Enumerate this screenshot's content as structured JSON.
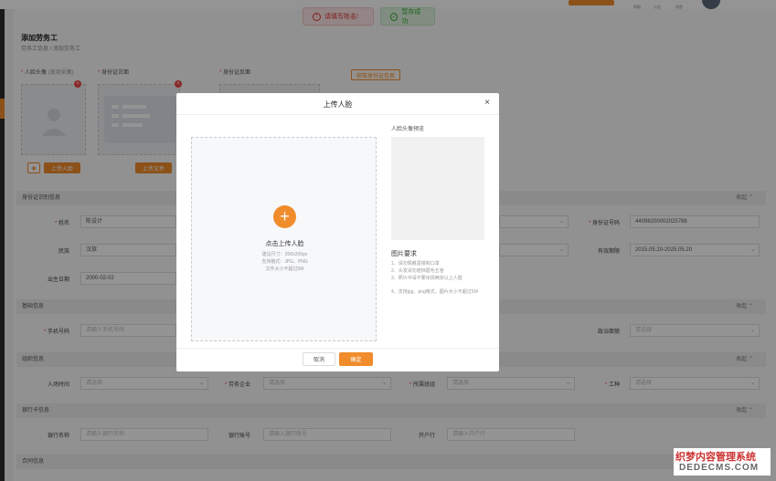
{
  "topbar": {
    "icons": [
      {
        "name": "help-icon",
        "label": "帮助"
      },
      {
        "name": "notice-icon",
        "label": "公告"
      },
      {
        "name": "message-icon",
        "label": "消息"
      }
    ]
  },
  "toasts": {
    "error": "请填写姓名!",
    "success": "暂存成功"
  },
  "page": {
    "title": "添加劳务工",
    "breadcrumb": "劳务工信息 / 添加劳务工"
  },
  "upload": {
    "face_label": "人脸头像",
    "face_hint": "(现场采集)",
    "id_front_label": "身份证正面",
    "id_back_label": "身份证反面",
    "read_id_button": "获取身份证信息",
    "upload_face_button": "上传人脸",
    "upload_file_button": "上传文件"
  },
  "sections": {
    "id_info": "身份证识别信息",
    "basic": "基础信息",
    "org": "组织信息",
    "bank": "银行卡信息",
    "contract": "合同信息",
    "collapse": "收起 ⌃"
  },
  "fields": {
    "name_label": "姓名",
    "name_value": "陈设计",
    "idno_label": "身份证号码",
    "idno_value": "44098200002025788",
    "ethnic_label": "民族",
    "ethnic_value": "汉族",
    "validity_label": "有效期限",
    "validity_value": "2015.05.20-2025.05.20",
    "birth_label": "出生日期",
    "birth_value": "2000-02-02",
    "phone_label": "手机号码",
    "phone_placeholder": "请输入手机号码",
    "politics_label": "政治面貌",
    "politics_placeholder": "请选择",
    "join_label": "入场时间",
    "join_placeholder": "请选择",
    "company_label": "劳务企业",
    "company_placeholder": "请选择",
    "team_label": "所属班组",
    "team_placeholder": "请选择",
    "work_label": "工种",
    "work_placeholder": "请选择",
    "bankname_label": "银行名称",
    "bankname_placeholder": "请输入银行名称",
    "bankno_label": "银行账号",
    "bankno_placeholder": "请输入银行账号",
    "branch_label": "开户行",
    "branch_placeholder": "请输入开户行"
  },
  "modal": {
    "title": "上传人脸",
    "drop_title": "点击上传人脸",
    "drop_size": "建议尺寸：200x200px",
    "drop_format": "支持格式：JPG、PNG",
    "drop_limit": "文件大小不超过5M",
    "preview_label": "人脸头像预览",
    "req_title": "图片要求",
    "req_items": [
      "1、请勿佩戴墨镜和口罩",
      "2、头发请勿遮挡眉毛五官",
      "3、照片中请不要出现两张以上人脸",
      "4、支持jpg、png格式，图片大小不超过5M"
    ],
    "cancel": "取消",
    "confirm": "确定"
  },
  "watermark": {
    "line1": "织梦内容管理系统",
    "line2": "DEDECMS.COM"
  },
  "colors": {
    "accent": "#f08c2c",
    "error": "#dd3333",
    "success": "#33aa33"
  }
}
